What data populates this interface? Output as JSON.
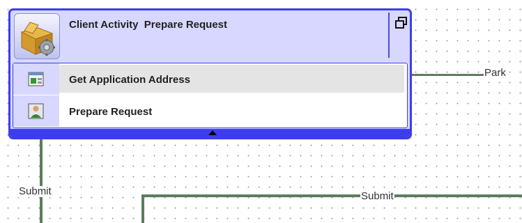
{
  "node": {
    "title": "Client Activity  Prepare Request",
    "items": [
      {
        "label": "Get Application Address",
        "icon": "application-address-icon",
        "selected": true
      },
      {
        "label": "Prepare Request",
        "icon": "user-request-icon",
        "selected": false
      }
    ]
  },
  "connections": {
    "park_label": "Park",
    "submit_label_left": "Submit",
    "submit_label_right": "Submit"
  },
  "colors": {
    "node_border": "#3d3df0",
    "node_fill": "#d7d7ff",
    "connector": "#5d7d5d",
    "selection": "#e4e4e4"
  }
}
